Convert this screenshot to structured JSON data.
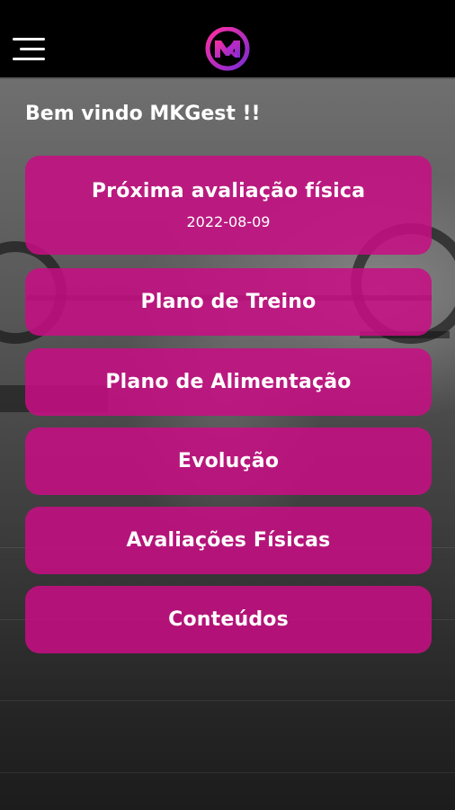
{
  "header": {
    "menu_icon": "hamburger-menu-icon",
    "logo_icon": "mk-logo-icon",
    "logo_text": "MK"
  },
  "welcome": "Bem vindo MKGest !!",
  "cards": [
    {
      "label": "Próxima avaliação física",
      "date": "2022-08-09"
    },
    {
      "label": "Plano de Treino"
    },
    {
      "label": "Plano de Alimentação"
    },
    {
      "label": "Evolução"
    },
    {
      "label": "Avaliações Físicas"
    },
    {
      "label": "Conteúdos"
    }
  ],
  "colors": {
    "card": "#C80E84",
    "header": "#000000",
    "text": "#FFFFFF"
  }
}
